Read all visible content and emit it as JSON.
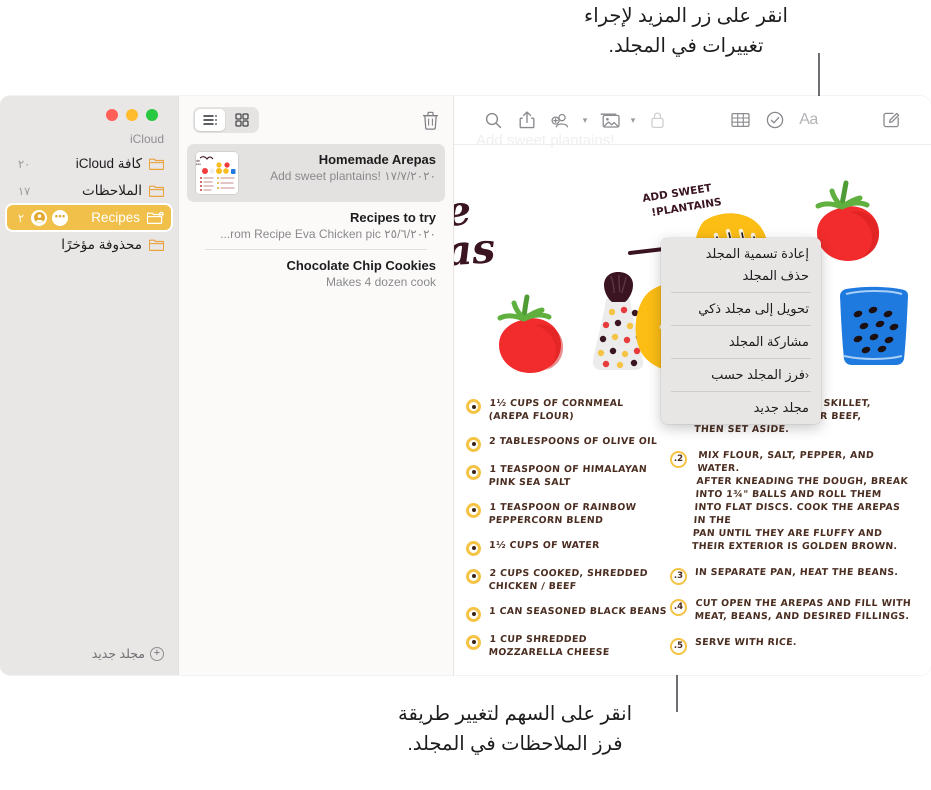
{
  "annotations": {
    "top": "انقر على زر المزيد لإجراء\nتغييرات في المجلد.",
    "bottom": "انقر على السهم لتغيير طريقة\nفرز الملاحظات في المجلد."
  },
  "window": {
    "traffic_lights": [
      "green",
      "yellow",
      "red"
    ]
  },
  "sidebar": {
    "section_label": "iCloud",
    "items": [
      {
        "label": "كافة iCloud",
        "count": "٢٠",
        "icon": "folder-icon",
        "selected": false
      },
      {
        "label": "الملاحظات",
        "count": "١٧",
        "icon": "folder-icon",
        "selected": false
      },
      {
        "label": "Recipes",
        "count": "٢",
        "icon": "shared-folder-icon",
        "selected": true,
        "person_icon": "person-icon",
        "more_icon": "more-icon"
      },
      {
        "label": "محذوفة مؤخرًا",
        "count": "",
        "icon": "folder-icon",
        "selected": false
      }
    ],
    "new_folder_label": "مجلد جديد",
    "new_folder_icon": "plus-circle-icon",
    "accent_color": "#f0c04a",
    "folder_icon_color": "#e8a33d"
  },
  "notelist": {
    "delete_icon": "trash-icon",
    "view_grid_icon": "grid-view-icon",
    "view_list_icon": "list-view-icon",
    "active_view": "list",
    "notes": [
      {
        "title": "Homemade Arepas",
        "date": "١٧/٧/٢٠٢٠",
        "preview": "Add sweet plantains!",
        "selected": true,
        "has_thumbnail": true
      },
      {
        "title": "Recipes to try",
        "date": "٢٥/٦/٢٠٢٠",
        "preview": "...rom Recipe Eva Chicken pic",
        "selected": false,
        "has_thumbnail": false
      },
      {
        "title": "Chocolate Chip Cookies",
        "date": "",
        "preview": "Makes 4 dozen cook",
        "selected": false,
        "has_thumbnail": false
      }
    ]
  },
  "detail_toolbar": {
    "icons": [
      {
        "name": "search-icon",
        "label": "بحث"
      },
      {
        "name": "share-icon",
        "label": "مشاركة"
      },
      {
        "name": "add-person-icon",
        "label": "إضافة أشخاص"
      },
      {
        "name": "media-icon",
        "label": "وسائط"
      },
      {
        "name": "lock-icon",
        "label": "قفل"
      },
      {
        "name": "table-icon",
        "label": "جدول"
      },
      {
        "name": "checklist-icon",
        "label": "قائمة تحقق"
      },
      {
        "name": "format-icon",
        "label": "Aa"
      },
      {
        "name": "compose-icon",
        "label": "ملاحظة جديدة"
      }
    ],
    "format_label": "Aa"
  },
  "note": {
    "faded_header": "Add sweet plantains!",
    "illustration": {
      "title_line1": "Homemade",
      "title_line2": "Arepas",
      "callout": "ADD SWEET\nPLANTAINS!"
    },
    "ingredients": [
      "1½ CUPS OF CORNMEAL\n(AREPA FLOUR)",
      "2 TABLESPOONS OF OLIVE OIL",
      "1 TEASPOON OF HIMALAYAN\nPINK SEA SALT",
      "1 TEASPOON OF RAINBOW\nPEPPERCORN BLEND",
      "1½ CUPS OF WATER",
      "2 CUPS COOKED, SHREDDED\nCHICKEN / BEEF",
      "1 CAN SEASONED BLACK BEANS",
      "1 CUP SHREDDED\nMOZZARELLA CHEESE"
    ],
    "steps": [
      {
        "num": "1.",
        "text": "IN A LARGE NONSTICK SKILLET,\nWARM THE CHICKEN OR BEEF,\nTHEN SET ASIDE."
      },
      {
        "num": "2.",
        "text": "MIX FLOUR, SALT, PEPPER, AND WATER.\nAFTER KNEADING THE DOUGH, BREAK\nINTO 1¾\" BALLS AND ROLL THEM\nINTO FLAT DISCS. COOK THE AREPAS IN THE\nPAN UNTIL THEY ARE FLUFFY AND\nTHEIR EXTERIOR IS GOLDEN BROWN."
      },
      {
        "num": "3.",
        "text": "IN SEPARATE PAN, HEAT THE BEANS."
      },
      {
        "num": "4.",
        "text": "CUT OPEN THE AREPAS AND FILL WITH\nMEAT, BEANS, AND DESIRED FILLINGS."
      },
      {
        "num": "5.",
        "text": "SERVE WITH RICE."
      }
    ]
  },
  "context_menu": {
    "items": [
      {
        "label": "إعادة تسمية المجلد",
        "submenu": false,
        "separator_after": false
      },
      {
        "label": "حذف المجلد",
        "submenu": false,
        "separator_after": true
      },
      {
        "label": "تحويل إلى مجلد ذكي",
        "submenu": false,
        "separator_after": true
      },
      {
        "label": "مشاركة المجلد",
        "submenu": false,
        "separator_after": true
      },
      {
        "label": "فرز المجلد حسب",
        "submenu": true,
        "separator_after": true
      },
      {
        "label": "مجلد جديد",
        "submenu": false,
        "separator_after": false
      }
    ]
  }
}
